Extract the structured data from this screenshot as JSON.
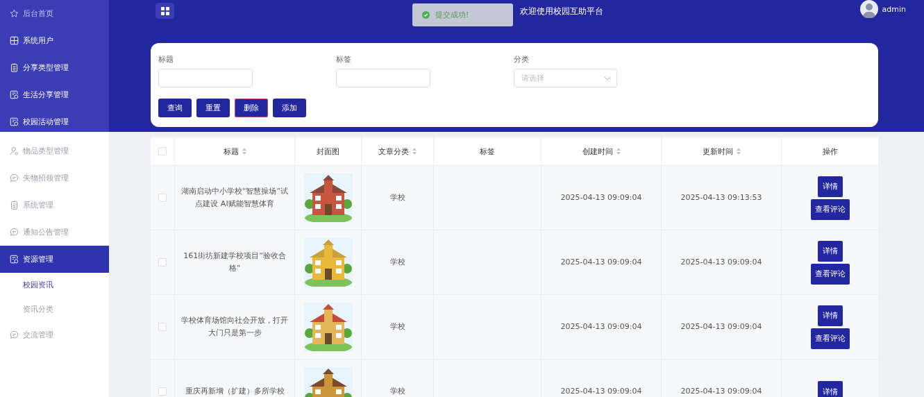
{
  "header": {
    "title": "欢迎使用校园互助平台",
    "user": "admin"
  },
  "toast": {
    "message": "提交成功!"
  },
  "sidebar": {
    "sections": [
      {
        "items": [
          {
            "label": "后台首页",
            "selected": false
          },
          {
            "label": "系统用户",
            "selected": false
          },
          {
            "label": "分享类型管理",
            "selected": false
          },
          {
            "label": "生活分享管理",
            "selected": false
          },
          {
            "label": "校园活动管理",
            "selected": false
          }
        ]
      },
      {
        "items": [
          {
            "label": "物品类型管理",
            "selected": false
          },
          {
            "label": "失物招领管理",
            "selected": false
          },
          {
            "label": "系统管理",
            "selected": false
          },
          {
            "label": "通知公告管理",
            "selected": false
          },
          {
            "label": "资源管理",
            "selected": true,
            "children": [
              {
                "label": "校园资讯",
                "selected": true
              },
              {
                "label": "资讯分类",
                "selected": false
              }
            ]
          },
          {
            "label": "交流管理",
            "selected": false
          }
        ]
      }
    ]
  },
  "search": {
    "fields": [
      {
        "label": "标题",
        "kind": "text"
      },
      {
        "label": "标签",
        "kind": "text"
      },
      {
        "label": "分类",
        "kind": "select",
        "placeholder": "请选择"
      }
    ],
    "buttons": [
      "查询",
      "重置",
      "删除",
      "添加"
    ]
  },
  "table": {
    "all_checked": false,
    "columns": [
      {
        "label": "标题",
        "sortable": true
      },
      {
        "label": "封面图",
        "sortable": false
      },
      {
        "label": "文章分类",
        "sortable": true
      },
      {
        "label": "标签",
        "sortable": false
      },
      {
        "label": "创建时间",
        "sortable": true
      },
      {
        "label": "更新时间",
        "sortable": true
      },
      {
        "label": "操作",
        "sortable": false
      }
    ],
    "rows": [
      {
        "checked": false,
        "title": "湖南启动中小学校“智慧操场”试点建设 AI赋能智慧体育",
        "category": "学校",
        "created": "2025-04-13 09:09:04",
        "updated": "2025-04-13 09:13:53",
        "actions": [
          "详情",
          "查看评论"
        ]
      },
      {
        "checked": false,
        "title": "161街坊新建学校项目“验收合格”",
        "category": "学校",
        "created": "2025-04-13 09:09:04",
        "updated": "2025-04-13 09:09:04",
        "actions": [
          "详情",
          "查看评论"
        ]
      },
      {
        "checked": false,
        "title": "学校体育场馆向社会开放，打开大门只是第一步",
        "category": "学校",
        "created": "2025-04-13 09:09:04",
        "updated": "2025-04-13 09:09:04",
        "actions": [
          "详情",
          "查看评论"
        ]
      },
      {
        "checked": false,
        "title": "重庆再新增（扩建）多所学校",
        "category": "学校",
        "created": "2025-04-13 09:09:04",
        "updated": "2025-04-13 09:09:04",
        "actions": [
          "详情"
        ]
      }
    ]
  }
}
